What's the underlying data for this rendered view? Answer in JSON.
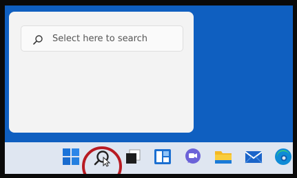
{
  "search": {
    "placeholder": "Select here to search"
  },
  "taskbar": {
    "icons": [
      "windows-start-icon",
      "search-icon",
      "task-view-icon",
      "widgets-icon",
      "chat-icon",
      "file-explorer-icon",
      "mail-icon",
      "edge-icon"
    ]
  },
  "annotation": {
    "ring_color": "#b81b23"
  },
  "colors": {
    "desktop": "#0f5fc0",
    "taskbar": "#dfe6f1",
    "panel": "#f3f3f3"
  }
}
